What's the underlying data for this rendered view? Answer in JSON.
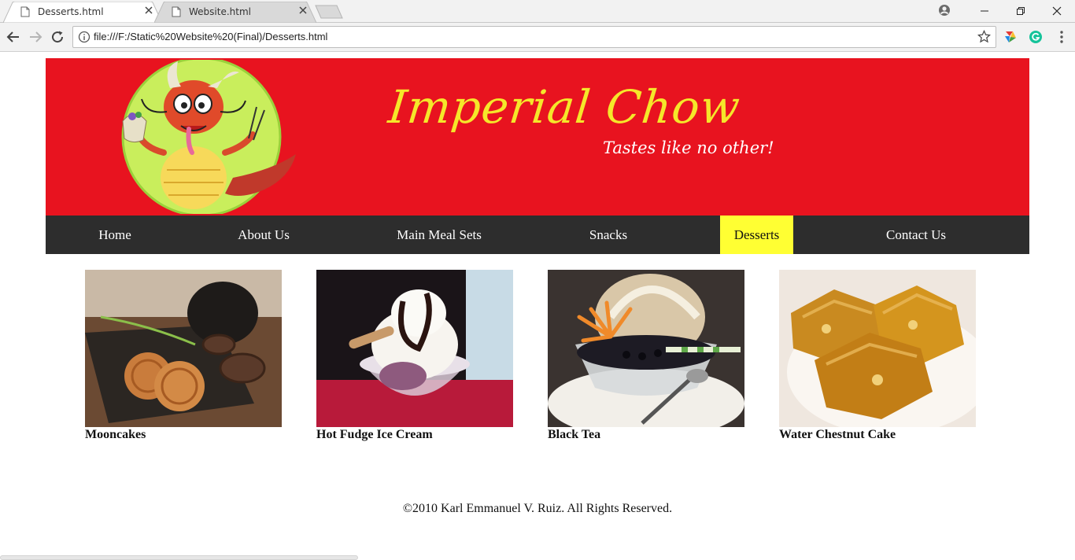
{
  "browser": {
    "tabs": [
      {
        "title": "Desserts.html",
        "active": true
      },
      {
        "title": "Website.html",
        "active": false
      }
    ],
    "url": "file:///F:/Static%20Website%20(Final)/Desserts.html"
  },
  "site": {
    "brand_name": "Imperial Chow",
    "tagline": "Tastes like no other!",
    "colors": {
      "banner": "#e8131f",
      "brand_text": "#f5e72a",
      "nav_bg": "#2d2d2d",
      "nav_active": "#ffff33"
    }
  },
  "nav": {
    "items": [
      {
        "label": "Home"
      },
      {
        "label": "About Us"
      },
      {
        "label": "Main Meal Sets"
      },
      {
        "label": "Snacks"
      },
      {
        "label": "Desserts",
        "active": true
      },
      {
        "label": "Contact Us"
      }
    ]
  },
  "desserts": [
    {
      "name": "Mooncakes"
    },
    {
      "name": "Hot Fudge Ice Cream"
    },
    {
      "name": "Black Tea"
    },
    {
      "name": "Water Chestnut Cake"
    }
  ],
  "footer": {
    "text": "©2010 Karl Emmanuel V. Ruiz. All Rights Reserved."
  }
}
